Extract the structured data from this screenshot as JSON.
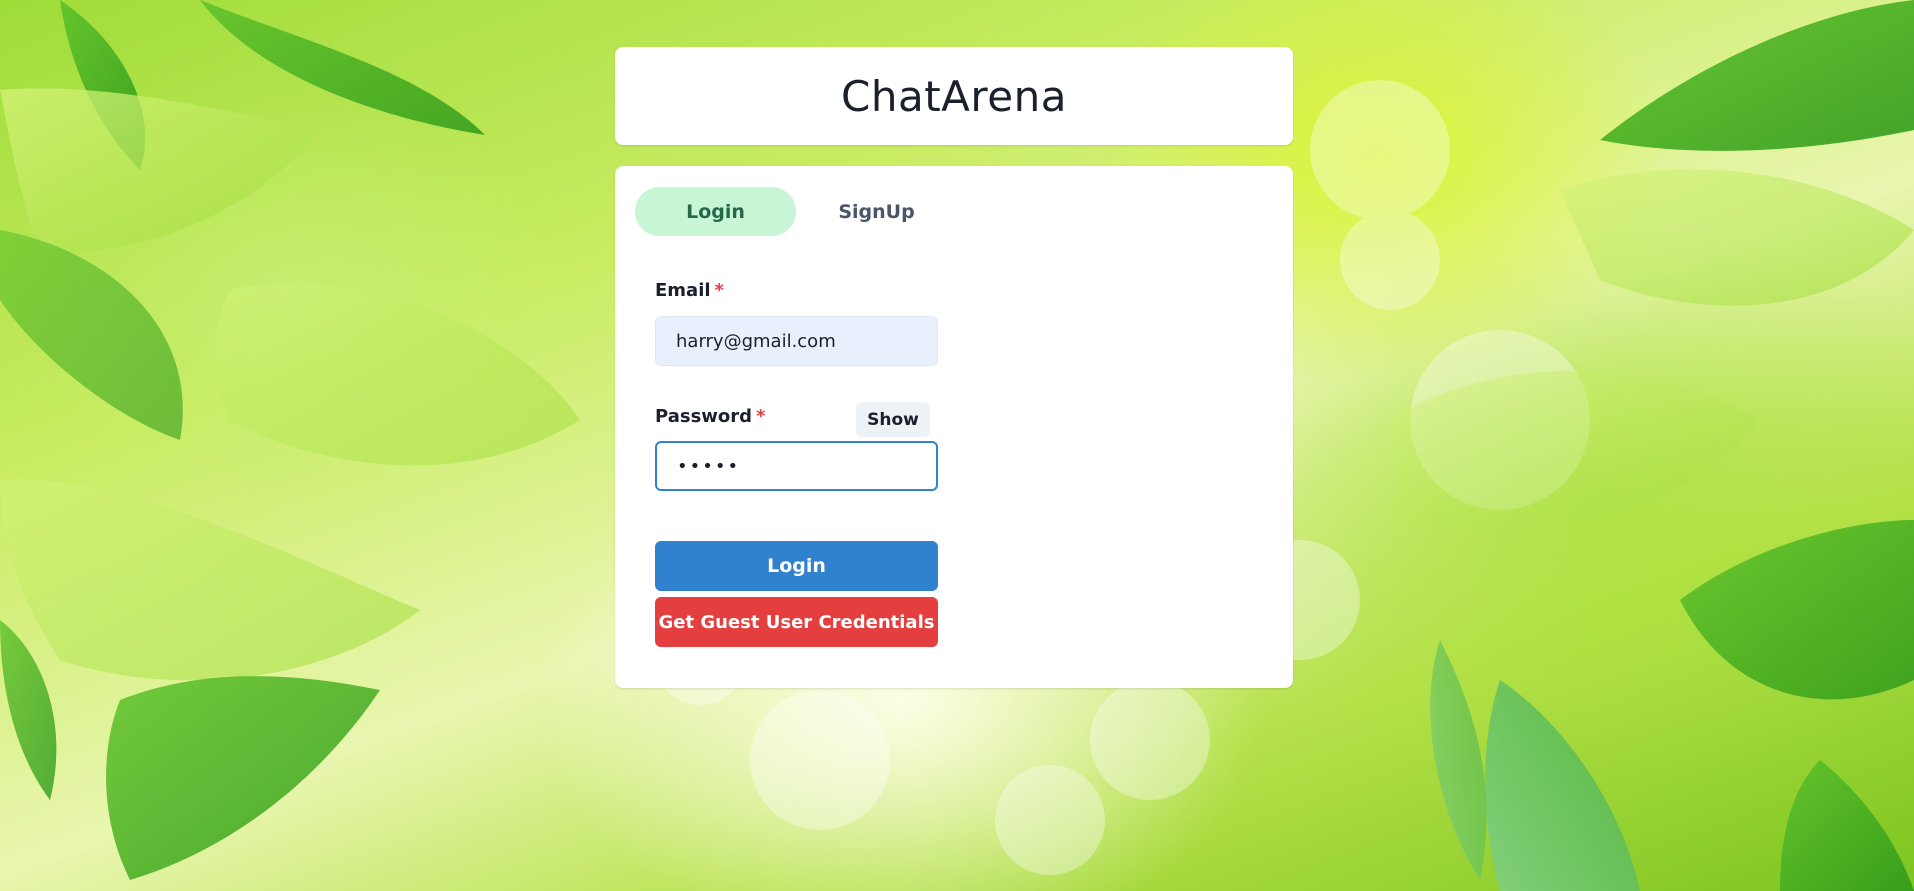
{
  "app": {
    "title": "ChatArena"
  },
  "tabs": [
    {
      "label": "Login",
      "active": true
    },
    {
      "label": "SignUp",
      "active": false
    }
  ],
  "form": {
    "email": {
      "label": "Email",
      "required_marker": "*",
      "value": "harry@gmail.com"
    },
    "password": {
      "label": "Password",
      "required_marker": "*",
      "value": "•••••",
      "toggle_label": "Show"
    },
    "submit_label": "Login",
    "guest_label": "Get Guest User Credentials"
  },
  "colors": {
    "active_tab_bg": "#c6f6d5",
    "active_tab_text": "#276749",
    "primary": "#3182ce",
    "danger": "#e53e3e",
    "email_input_bg": "#e8f0fe"
  }
}
